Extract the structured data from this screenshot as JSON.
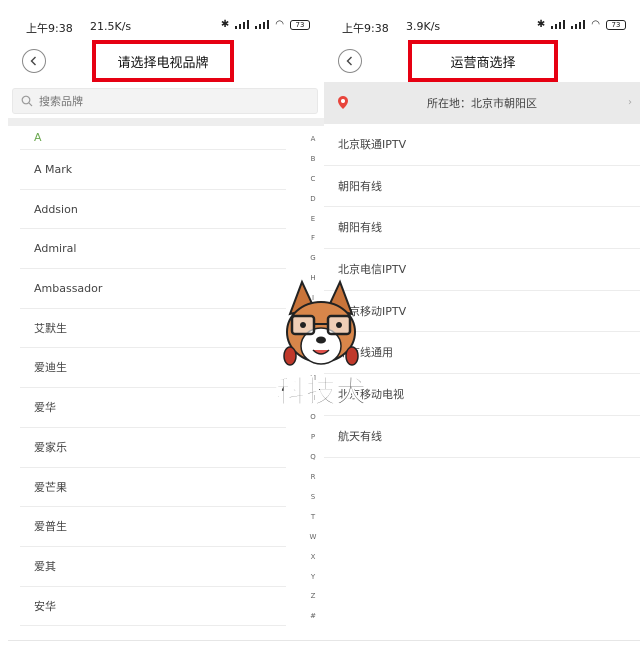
{
  "left": {
    "status": {
      "time": "上午9:38",
      "speed": "21.5K/s",
      "battery": "73"
    },
    "title": "请选择电视品牌",
    "search_placeholder": "搜索品牌",
    "section_letter": "A",
    "brands": [
      "A Mark",
      "Addsion",
      "Admiral",
      "Ambassador",
      "艾默生",
      "爱迪生",
      "爱华",
      "爱家乐",
      "爱芒果",
      "爱普生",
      "爱其",
      "安华"
    ],
    "index_letters": [
      "A",
      "B",
      "C",
      "D",
      "E",
      "F",
      "G",
      "H",
      "I",
      "J",
      "K",
      "L",
      "M",
      "N",
      "O",
      "P",
      "Q",
      "R",
      "S",
      "T",
      "W",
      "X",
      "Y",
      "Z",
      "#"
    ]
  },
  "right": {
    "status": {
      "time": "上午9:38",
      "speed": "3.9K/s",
      "battery": "73"
    },
    "title": "运营商选择",
    "location": "所在地：北京市朝阳区",
    "operators": [
      "北京联通IPTV",
      "朝阳有线",
      "朝阳有线",
      "北京电信IPTV",
      "北京移动IPTV",
      "华有线通用",
      "北京移动电视",
      "航天有线"
    ]
  },
  "watermark": {
    "text": "科技犬"
  },
  "colors": {
    "highlight_box": "#e60012",
    "section_letter": "#6aa84f",
    "location_pin": "#e8453c"
  }
}
